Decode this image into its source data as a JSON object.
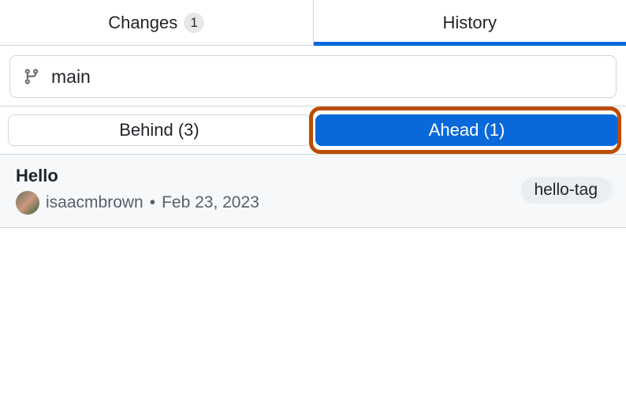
{
  "tabs": {
    "changes": {
      "label": "Changes",
      "count": "1"
    },
    "history": {
      "label": "History"
    }
  },
  "branch": {
    "name": "main"
  },
  "ahead_behind": {
    "behind_label": "Behind (3)",
    "ahead_label": "Ahead (1)"
  },
  "commit": {
    "title": "Hello",
    "author": "isaacmbrown",
    "separator": "•",
    "date": "Feb 23, 2023",
    "tag": "hello-tag"
  }
}
